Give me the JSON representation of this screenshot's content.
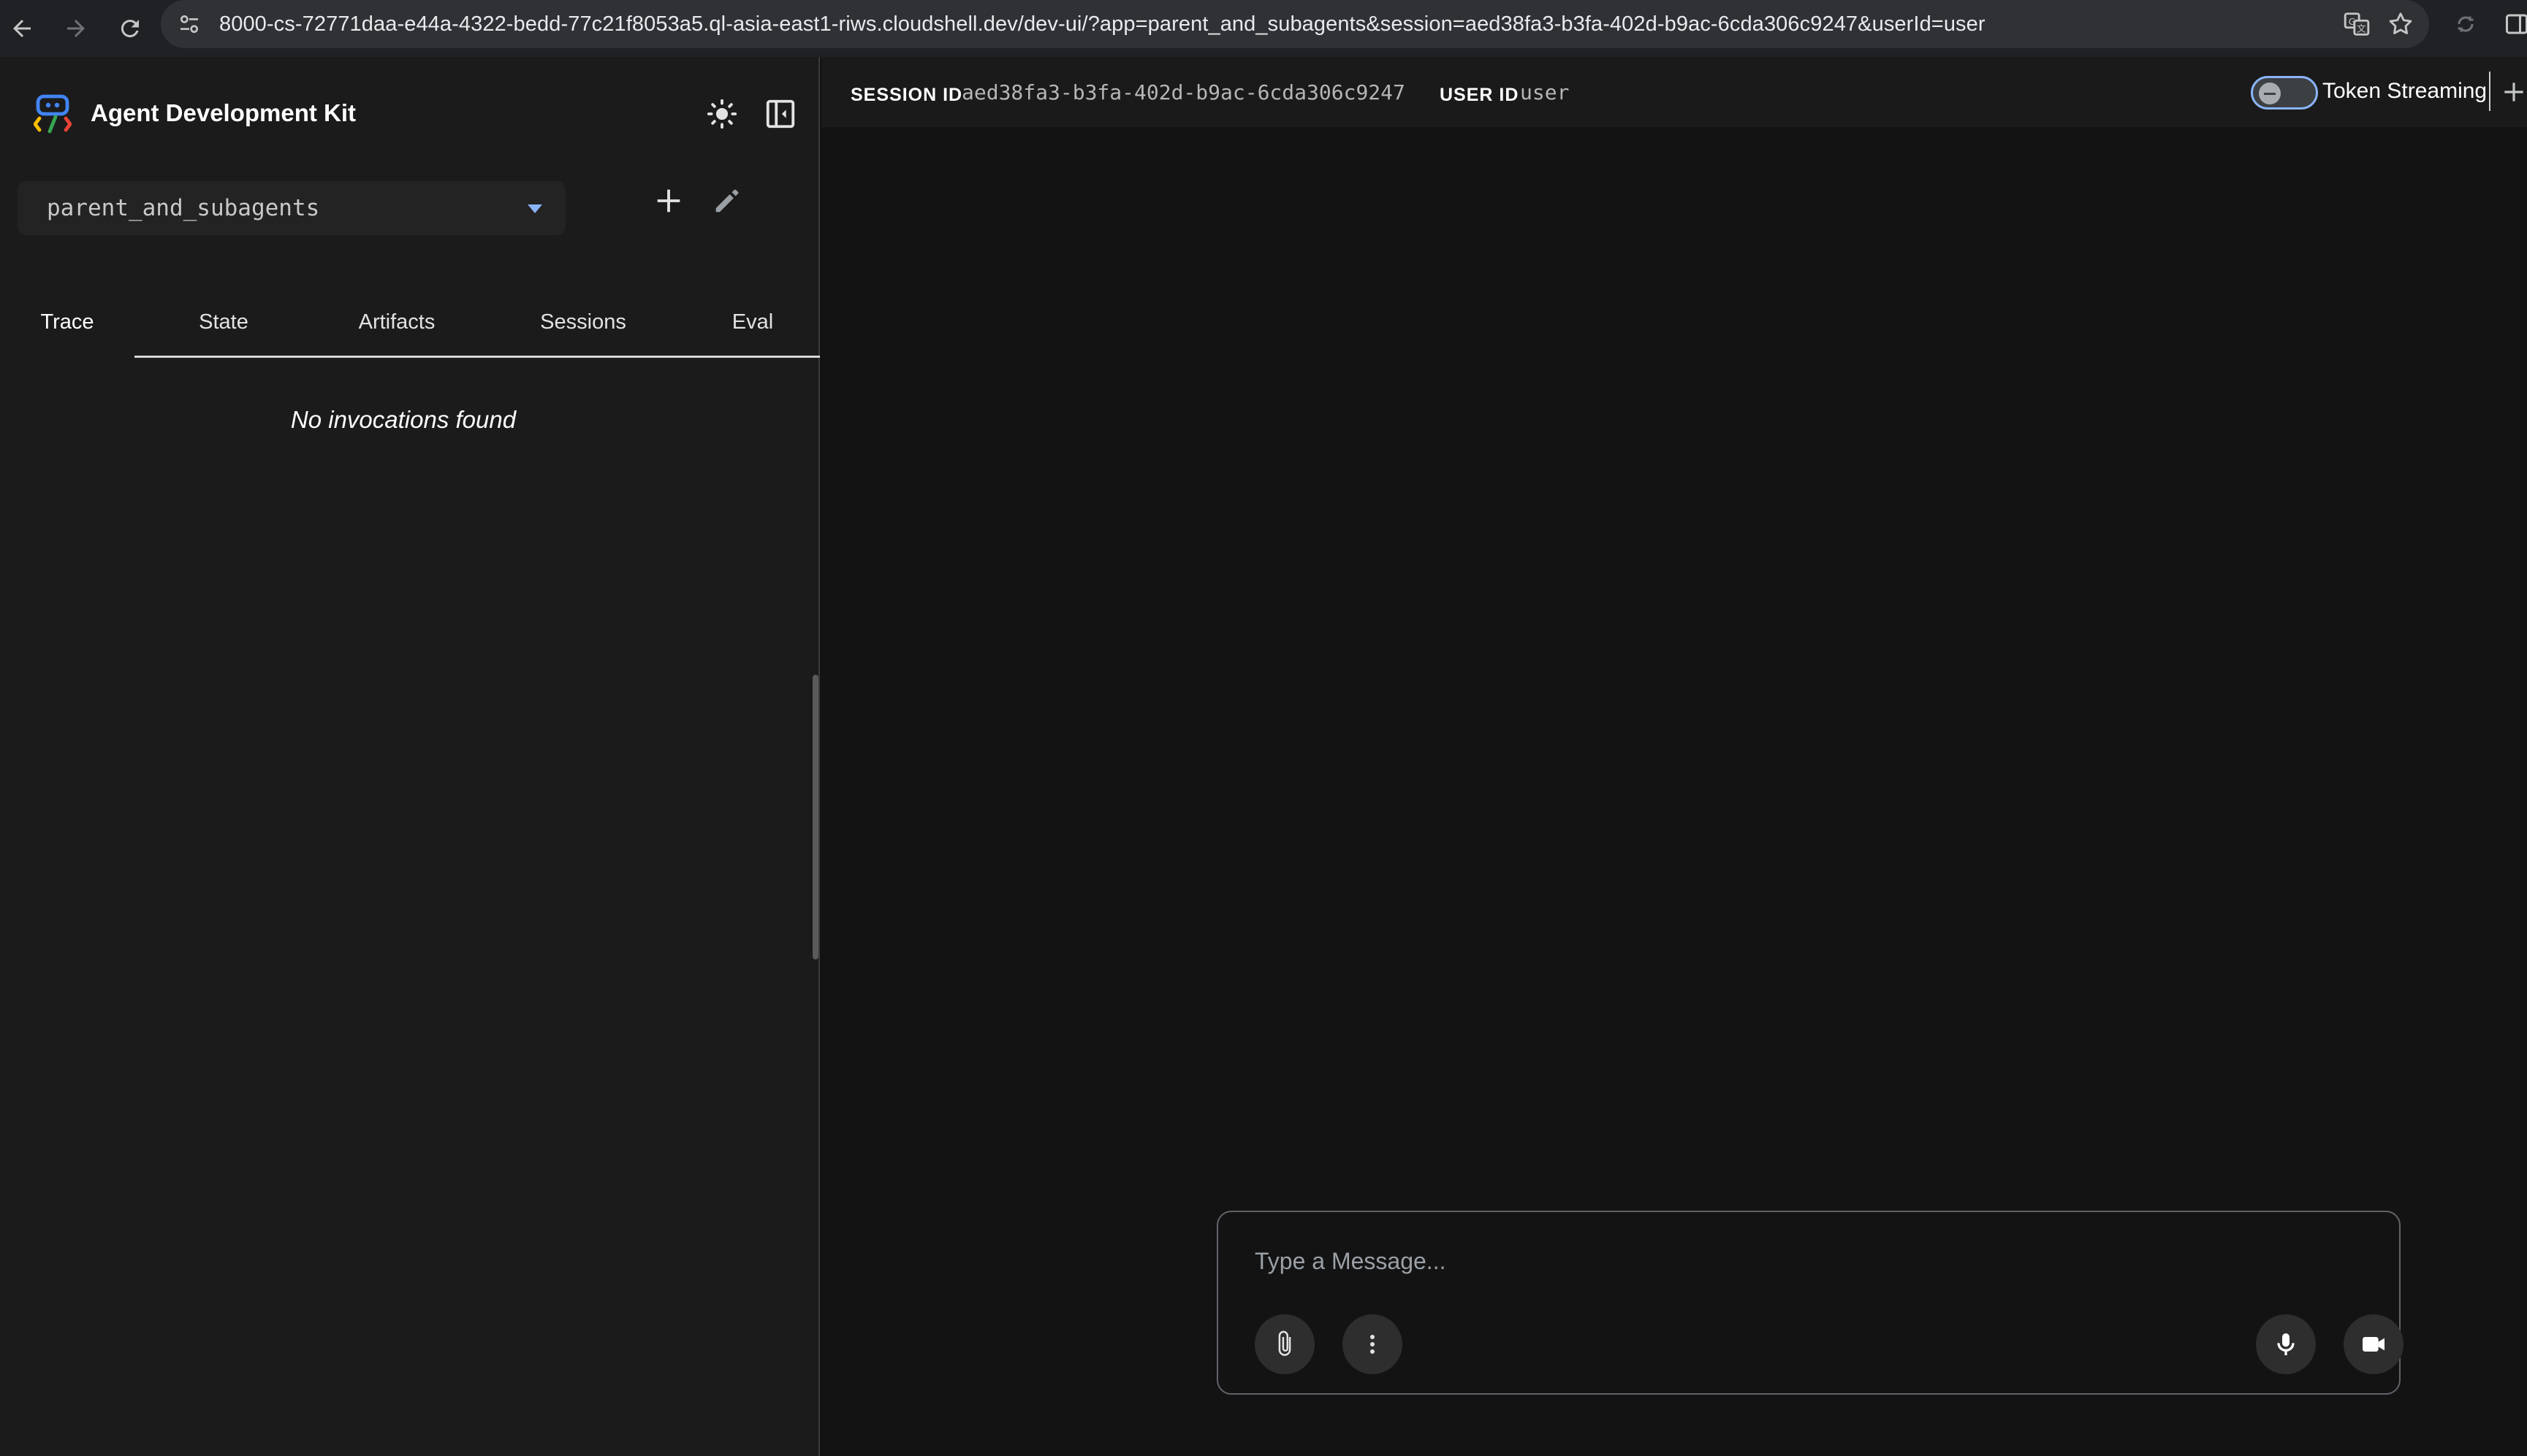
{
  "browser": {
    "url": "8000-cs-72771daa-e44a-4322-bedd-77c21f8053a5.ql-asia-east1-riws.cloudshell.dev/dev-ui/?app=parent_and_subagents&session=aed38fa3-b3fa-402d-b9ac-6cda306c9247&userId=user"
  },
  "sidebar": {
    "title": "Agent Development Kit",
    "app_select": {
      "value": "parent_and_subagents"
    },
    "tabs": [
      {
        "label": "Trace",
        "active": true
      },
      {
        "label": "State",
        "active": false
      },
      {
        "label": "Artifacts",
        "active": false
      },
      {
        "label": "Sessions",
        "active": false
      },
      {
        "label": "Eval",
        "active": false
      }
    ],
    "empty_message": "No invocations found"
  },
  "session_bar": {
    "session_label": "SESSION ID",
    "session_id": "aed38fa3-b3fa-402d-b9ac-6cda306c9247",
    "user_label": "USER ID",
    "user_id": "user",
    "token_streaming_label": "Token Streaming",
    "token_streaming_on": false
  },
  "composer": {
    "placeholder": "Type a Message..."
  },
  "icons": {
    "back": "arrow-back-icon",
    "forward": "arrow-forward-icon",
    "reload": "reload-icon",
    "site_settings": "tune-icon",
    "translate": "translate-icon",
    "bookmark": "star-icon",
    "theme": "sun-icon",
    "panel": "dock-left-icon",
    "add": "plus-icon",
    "edit": "pencil-icon",
    "attach": "paperclip-icon",
    "more": "more-vert-icon",
    "mic": "mic-icon",
    "video": "videocam-icon"
  },
  "colors": {
    "background": "#131313",
    "sidebar": "#1b1b1b",
    "accent": "#8ab4f8"
  }
}
